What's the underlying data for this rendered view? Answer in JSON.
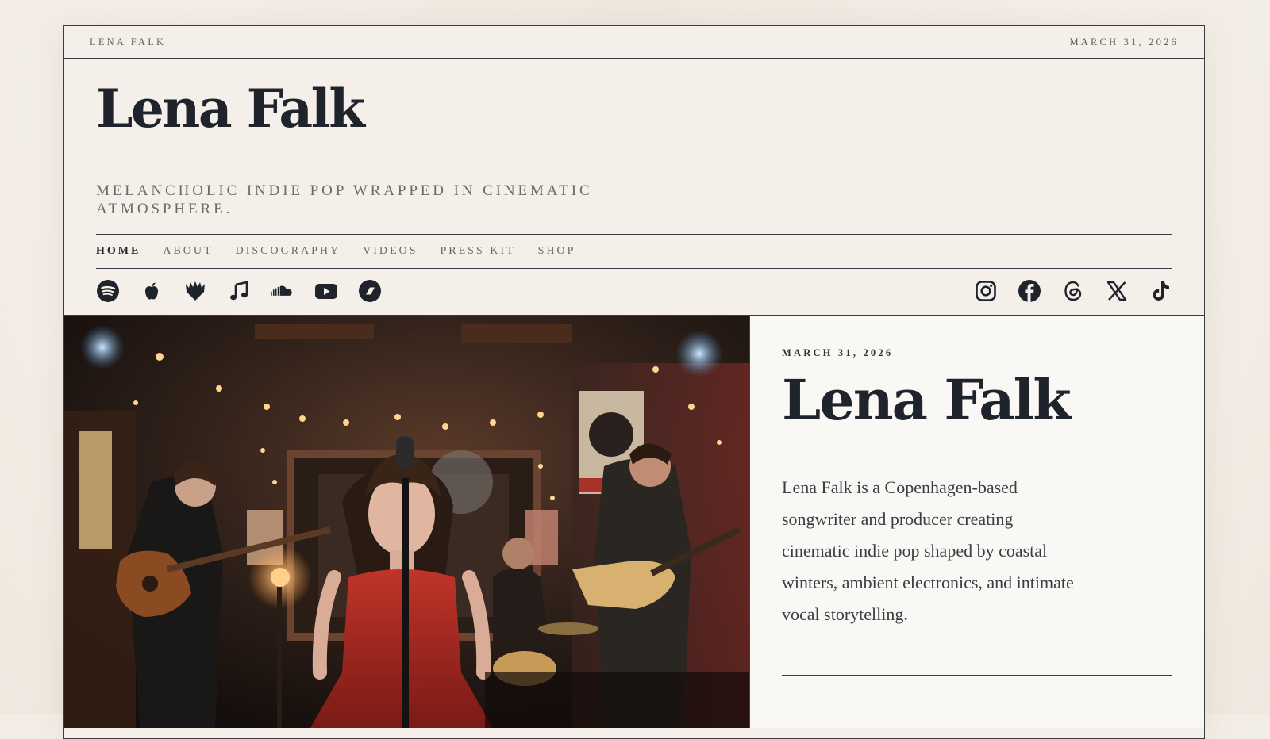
{
  "topbar": {
    "site_name": "LENA FALK",
    "date": "MARCH 31, 2026"
  },
  "masthead": {
    "title": "Lena Falk",
    "tagline": "MELANCHOLIC INDIE POP WRAPPED IN CINEMATIC ATMOSPHERE."
  },
  "nav": {
    "items": [
      {
        "label": "HOME",
        "active": true
      },
      {
        "label": "ABOUT"
      },
      {
        "label": "DISCOGRAPHY"
      },
      {
        "label": "VIDEOS"
      },
      {
        "label": "PRESS KIT"
      },
      {
        "label": "SHOP"
      }
    ]
  },
  "streaming_icons": [
    "spotify-icon",
    "apple-music-icon",
    "deezer-icon",
    "music-note-icon",
    "soundcloud-icon",
    "youtube-icon",
    "bandcamp-icon"
  ],
  "social_icons": [
    "instagram-icon",
    "facebook-icon",
    "threads-icon",
    "x-icon",
    "tiktok-icon"
  ],
  "feature": {
    "date": "MARCH 31, 2026",
    "title": "Lena Falk",
    "body": "Lena Falk is a Copenhagen-based songwriter and producer creating cinematic indie pop shaped by coastal winters, ambient electronics, and intimate vocal storytelling."
  },
  "colors": {
    "ink": "#1f242c",
    "paper": "#f4f0e9",
    "panel": "#faf8f4",
    "rule": "#3a3d44"
  }
}
